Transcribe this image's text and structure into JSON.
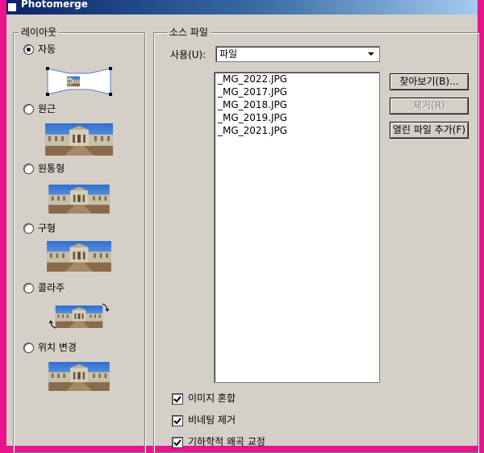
{
  "window": {
    "title": "Photomerge"
  },
  "layout_group": {
    "title": "레이아웃",
    "options": [
      {
        "label": "자동",
        "checked": true
      },
      {
        "label": "원근",
        "checked": false
      },
      {
        "label": "원통형",
        "checked": false
      },
      {
        "label": "구형",
        "checked": false
      },
      {
        "label": "콜라주",
        "checked": false
      },
      {
        "label": "위치 변경",
        "checked": false
      }
    ]
  },
  "source_group": {
    "title": "소스 파일",
    "use_label": "사용(U):",
    "use_value": "파일",
    "files": [
      "_MG_2022.JPG",
      "_MG_2017.JPG",
      "_MG_2018.JPG",
      "_MG_2019.JPG",
      "_MG_2021.JPG"
    ],
    "browse_button": "찾아보기(B)...",
    "remove_button": "제거(R)",
    "add_open_button": "열린 파일 추가(F)"
  },
  "options": [
    {
      "label": "이미지 혼합",
      "checked": true
    },
    {
      "label": "비네팅 제거",
      "checked": true
    },
    {
      "label": "기하학적 왜곡 교정",
      "checked": true
    }
  ],
  "colors": {
    "frame": "#e8158a",
    "face": "#d4d0c8",
    "titlebar": "#0a246a"
  }
}
